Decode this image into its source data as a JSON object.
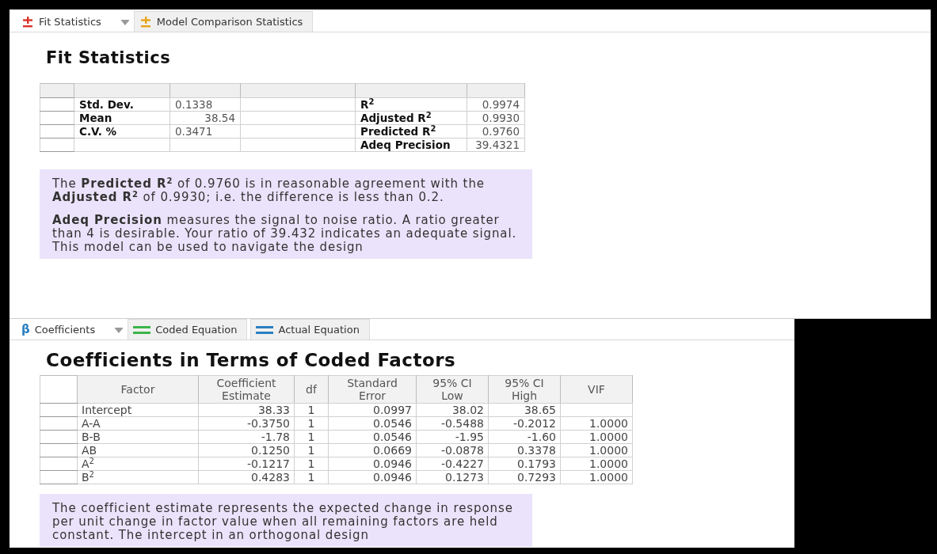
{
  "panels": [
    {
      "tabs": [
        {
          "label": "Fit Statistics",
          "kind": "plusminus",
          "color": "#d9342b",
          "selected": true,
          "dropdown": true
        },
        {
          "label": "Model Comparison Statistics",
          "kind": "plusminus",
          "color": "#e8a317",
          "selected": false,
          "dropdown": false
        }
      ],
      "title": "Fit Statistics",
      "fit_table": {
        "rows": [
          {
            "label_1": "Std. Dev.",
            "value_1": "0.1338",
            "label_2": "R$^{2}$",
            "value_2": "0.9974"
          },
          {
            "label_1": "Mean",
            "value_1": "38.54",
            "label_2": "Adjusted R$^{2}$",
            "value_2": "0.9930"
          },
          {
            "label_1": "C.V. %",
            "value_1": "0.3471",
            "label_2": "Predicted R$^{2}$",
            "value_2": "0.9760"
          },
          {
            "label_2": "Adeq Precision",
            "value_2": "39.4321"
          }
        ]
      },
      "notes": [
        "The **Predicted R$^{2}$** of 0.9760 is in reasonable agreement with the **Adjusted R$^{2}$** of 0.9930; i.e. the difference is less than 0.2.",
        "**Adeq Precision** measures the signal to noise ratio. A ratio greater than 4 is desirable. Your ratio of 39.432 indicates an adequate signal. This model can be used to navigate the design"
      ]
    },
    {
      "tabs": [
        {
          "label": "Coefficients",
          "kind": "beta",
          "glyph": "β",
          "color": "#2a7fc1",
          "selected": true,
          "dropdown": true
        },
        {
          "label": "Coded Equation",
          "kind": "equals",
          "color": "#3bb54a",
          "selected": false,
          "dropdown": false
        },
        {
          "label": "Actual Equation",
          "kind": "equals",
          "color": "#2a7fc1",
          "selected": false,
          "dropdown": false
        }
      ],
      "title": "Coefficients in Terms of Coded Factors",
      "coef_table": {
        "columns": [
          "Factor",
          "Coefficient Estimate",
          "df",
          "Standard Error",
          "95% CI Low",
          "95% CI High",
          "VIF"
        ],
        "rows": [
          [
            "Intercept",
            "38.33",
            "1",
            "0.0997",
            "38.02",
            "38.65",
            ""
          ],
          [
            "A-A",
            "-0.3750",
            "1",
            "0.0546",
            "-0.5488",
            "-0.2012",
            "1.0000"
          ],
          [
            "B-B",
            "-1.78",
            "1",
            "0.0546",
            "-1.95",
            "-1.60",
            "1.0000"
          ],
          [
            "AB",
            "0.1250",
            "1",
            "0.0669",
            "-0.0878",
            "0.3378",
            "1.0000"
          ],
          [
            "A$^{2}$",
            "-0.1217",
            "1",
            "0.0946",
            "-0.4227",
            "0.1793",
            "1.0000"
          ],
          [
            "B$^{2}$",
            "0.4283",
            "1",
            "0.0946",
            "0.1273",
            "0.7293",
            "1.0000"
          ]
        ]
      },
      "notes": [
        "The coefficient estimate represents the expected change in response per unit change in factor value when all remaining factors are held constant. The intercept in an orthogonal design"
      ]
    }
  ]
}
